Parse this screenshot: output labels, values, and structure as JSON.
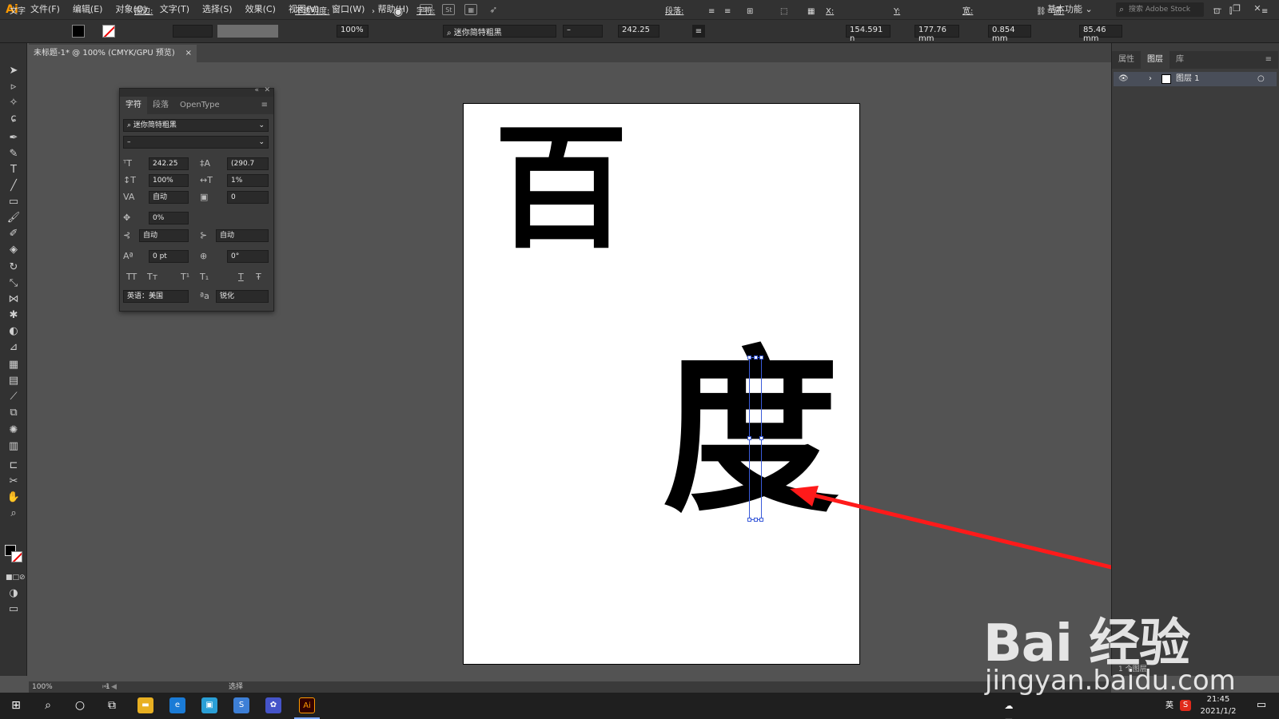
{
  "app": {
    "logo": "Ai"
  },
  "menu": [
    "文件(F)",
    "编辑(E)",
    "对象(O)",
    "文字(T)",
    "选择(S)",
    "效果(C)",
    "视图(V)",
    "窗口(W)",
    "帮助(H)"
  ],
  "menubar_icons": [
    "Br",
    "St"
  ],
  "workspace": "基本功能",
  "stock_search_placeholder": "搜索 Adobe Stock",
  "control": {
    "tool_label": "文字",
    "stroke_label": "描边:",
    "opacity_label": "不透明度:",
    "opacity_value": "100%",
    "char_label": "字符:",
    "font_name": "迷你简特粗黑",
    "font_style": "–",
    "font_size": "242.25",
    "para_label": "段落:",
    "x_label": "X:",
    "x_value": "154.591 n",
    "y_label": "Y:",
    "y_value": "177.76 mm",
    "w_label": "宽:",
    "w_value": "0.854 mm",
    "h_label": "高:",
    "h_value": "85.46 mm"
  },
  "document_tab": {
    "title": "未标题-1* @ 100% (CMYK/GPU 预览)",
    "close": "×"
  },
  "artboard": {
    "char1": "百",
    "char2": "度"
  },
  "char_panel": {
    "tabs": [
      "字符",
      "段落",
      "OpenType"
    ],
    "font": "迷你简特粗黑",
    "style": "–",
    "size": "242.25",
    "leading": "(290.7",
    "vscale": "100%",
    "hscale": "1%",
    "kerning": "自动",
    "tracking": "0",
    "tsume": "0%",
    "aki_left": "自动",
    "aki_right": "自动",
    "baseline": "0 pt",
    "rotation": "0°",
    "language": "英语：美国",
    "antialias": "锐化",
    "style_buttons": [
      "TT",
      "Tт",
      "T¹",
      "T₁",
      "T",
      "Ŧ"
    ]
  },
  "right_panel": {
    "tabs": [
      "属性",
      "图层",
      "库"
    ],
    "layer_name": "图层 1",
    "footer": "1 个图层"
  },
  "status": {
    "zoom": "100%",
    "page": "1",
    "mode": "选择"
  },
  "taskbar": {
    "time": "21:45",
    "date": "2021/1/2",
    "ime": "英"
  },
  "watermark": {
    "logo": "Bai 经验",
    "url": "jingyan.baidu.com"
  },
  "colors": {
    "accent": "#3a5bd9",
    "arrow": "#ff1a1a",
    "ui_dark": "#323232",
    "ui_mid": "#535353",
    "ai_orange": "#ff9a00"
  }
}
